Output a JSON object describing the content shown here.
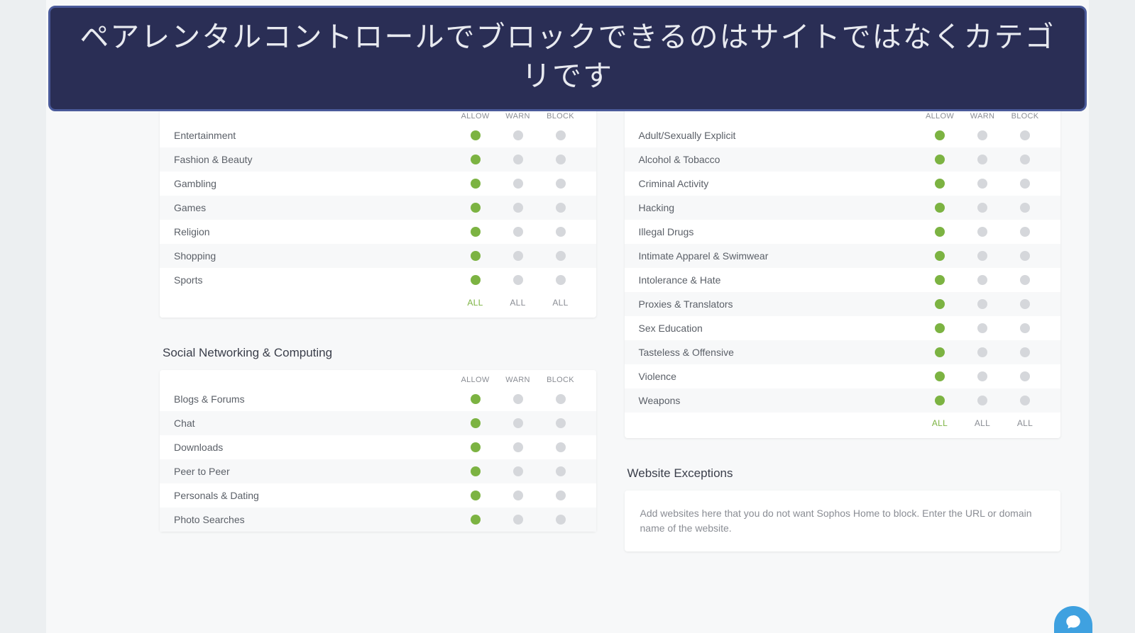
{
  "banner": "ペアレンタルコントロールでブロックできるのはサイトではなくカテゴリです",
  "headers": {
    "allow": "ALLOW",
    "warn": "WARN",
    "block": "BLOCK"
  },
  "all_label": "ALL",
  "colors": {
    "active": "#7cb342",
    "inactive": "#d5d7db"
  },
  "left": {
    "card1": {
      "active_col": 0,
      "rows": [
        {
          "label": "Entertainment",
          "sel": 0
        },
        {
          "label": "Fashion & Beauty",
          "sel": 0
        },
        {
          "label": "Gambling",
          "sel": 0
        },
        {
          "label": "Games",
          "sel": 0
        },
        {
          "label": "Religion",
          "sel": 0
        },
        {
          "label": "Shopping",
          "sel": 0
        },
        {
          "label": "Sports",
          "sel": 0
        }
      ]
    },
    "section2_title": "Social Networking & Computing",
    "card2": {
      "active_col": 0,
      "rows": [
        {
          "label": "Blogs & Forums",
          "sel": 0
        },
        {
          "label": "Chat",
          "sel": 0
        },
        {
          "label": "Downloads",
          "sel": 0
        },
        {
          "label": "Peer to Peer",
          "sel": 0
        },
        {
          "label": "Personals & Dating",
          "sel": 0
        },
        {
          "label": "Photo Searches",
          "sel": 0
        }
      ]
    }
  },
  "right": {
    "card1": {
      "active_col": 0,
      "rows": [
        {
          "label": "Adult/Sexually Explicit",
          "sel": 0
        },
        {
          "label": "Alcohol & Tobacco",
          "sel": 0
        },
        {
          "label": "Criminal Activity",
          "sel": 0
        },
        {
          "label": "Hacking",
          "sel": 0
        },
        {
          "label": "Illegal Drugs",
          "sel": 0
        },
        {
          "label": "Intimate Apparel & Swimwear",
          "sel": 0
        },
        {
          "label": "Intolerance & Hate",
          "sel": 0
        },
        {
          "label": "Proxies & Translators",
          "sel": 0
        },
        {
          "label": "Sex Education",
          "sel": 0
        },
        {
          "label": "Tasteless & Offensive",
          "sel": 0
        },
        {
          "label": "Violence",
          "sel": 0
        },
        {
          "label": "Weapons",
          "sel": 0
        }
      ]
    },
    "exceptions_title": "Website Exceptions",
    "exceptions_text": "Add websites here that you do not want Sophos Home to block. Enter the URL or domain name of the website."
  }
}
